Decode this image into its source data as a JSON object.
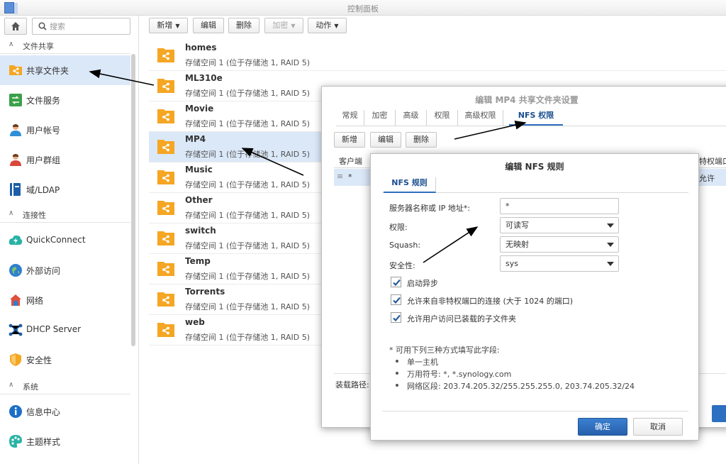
{
  "window": {
    "title": "控制面板"
  },
  "sidebar": {
    "search_placeholder": "搜索",
    "sections": [
      {
        "label": "文件共享"
      },
      {
        "label": "连接性"
      },
      {
        "label": "系统"
      }
    ],
    "items": [
      {
        "label": "共享文件夹",
        "icon": "shared-folder-icon"
      },
      {
        "label": "文件服务",
        "icon": "file-services-icon"
      },
      {
        "label": "用户帐号",
        "icon": "user-icon"
      },
      {
        "label": "用户群组",
        "icon": "group-icon"
      },
      {
        "label": "域/LDAP",
        "icon": "domain-icon"
      },
      {
        "label": "QuickConnect",
        "icon": "quickconnect-icon"
      },
      {
        "label": "外部访问",
        "icon": "external-access-icon"
      },
      {
        "label": "网络",
        "icon": "network-icon"
      },
      {
        "label": "DHCP Server",
        "icon": "dhcp-icon"
      },
      {
        "label": "安全性",
        "icon": "security-icon"
      },
      {
        "label": "信息中心",
        "icon": "info-icon"
      },
      {
        "label": "主题样式",
        "icon": "theme-icon"
      }
    ]
  },
  "toolbar": {
    "create": "新增",
    "edit": "编辑",
    "delete": "删除",
    "encrypt": "加密",
    "action": "动作"
  },
  "folders": [
    {
      "name": "homes",
      "desc": "存储空间 1 (位于存储池 1, RAID 5)"
    },
    {
      "name": "ML310e",
      "desc": "存储空间 1 (位于存储池 1, RAID 5)"
    },
    {
      "name": "Movie",
      "desc": "存储空间 1 (位于存储池 1, RAID 5)"
    },
    {
      "name": "MP4",
      "desc": "存储空间 1 (位于存储池 1, RAID 5)"
    },
    {
      "name": "Music",
      "desc": "存储空间 1 (位于存储池 1, RAID 5)"
    },
    {
      "name": "Other",
      "desc": "存储空间 1 (位于存储池 1, RAID 5)"
    },
    {
      "name": "switch",
      "desc": "存储空间 1 (位于存储池 1, RAID 5)"
    },
    {
      "name": "Temp",
      "desc": "存储空间 1 (位于存储池 1, RAID 5)"
    },
    {
      "name": "Torrents",
      "desc": "存储空间 1 (位于存储池 1, RAID 5)"
    },
    {
      "name": "web",
      "desc": "存储空间 1 (位于存储池 1, RAID 5)"
    }
  ],
  "share_dialog": {
    "title": "编辑 MP4 共享文件夹设置",
    "tabs": [
      "常规",
      "加密",
      "高级",
      "权限",
      "高级权限",
      "NFS 权限"
    ],
    "buttons": {
      "create": "新增",
      "edit": "编辑",
      "delete": "删除"
    },
    "columns": {
      "client": "客户端",
      "privileged_port": "特权端口"
    },
    "row": {
      "client": "*",
      "privileged_port": "允许"
    },
    "mount_path_label": "装载路径:"
  },
  "nfs_dialog": {
    "title": "编辑 NFS 规则",
    "tab": "NFS 规则",
    "fields": {
      "server_label": "服务器名称或 IP 地址*:",
      "server_value": "*",
      "privilege_label": "权限:",
      "privilege_value": "可读写",
      "squash_label": "Squash:",
      "squash_value": "无映射",
      "security_label": "安全性:",
      "security_value": "sys"
    },
    "checkboxes": [
      {
        "label": "启动异步",
        "checked": true
      },
      {
        "label": "允许来自非特权端口的连接 (大于 1024 的端口)",
        "checked": true
      },
      {
        "label": "允许用户访问已装载的子文件夹",
        "checked": true
      }
    ],
    "note": {
      "heading": "* 可用下列三种方式填写此字段:",
      "items": [
        "单一主机",
        "万用符号: *, *.synology.com",
        "网络区段: 203.74.205.32/255.255.255.0, 203.74.205.32/24"
      ]
    },
    "buttons": {
      "ok": "确定",
      "cancel": "取消"
    }
  },
  "colors": {
    "accent": "#2d6fc0",
    "folder": "#f5a623",
    "selection": "#dbe8f8"
  }
}
